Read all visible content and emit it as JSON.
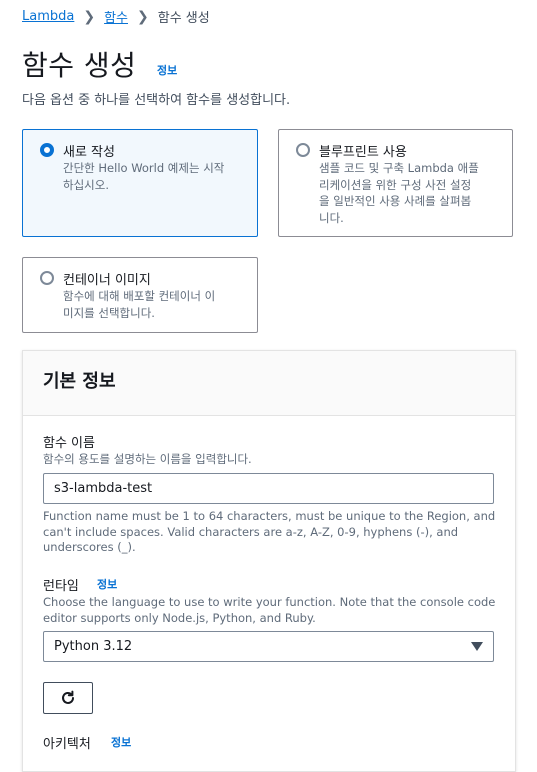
{
  "breadcrumb": {
    "items": [
      "Lambda",
      "함수"
    ],
    "current": "함수 생성"
  },
  "page": {
    "title": "함수 생성",
    "info_link": "정보",
    "subtitle": "다음 옵션 중 하나를 선택하여 함수를 생성합니다."
  },
  "options": [
    {
      "title": "새로 작성",
      "desc_lines": [
        "간단한 Hello World 예제는 시작",
        "하십시오."
      ],
      "selected": true
    },
    {
      "title": "블루프린트 사용",
      "desc_lines": [
        "샘플 코드 및 구축 Lambda 애플",
        "리케이션을 위한 구성 사전 설정",
        "을 일반적인 사용 사례를 살펴봅",
        "니다."
      ],
      "selected": false
    },
    {
      "title": "컨테이너 이미지",
      "desc_lines": [
        "함수에 대해 배포할 컨테이너 이",
        "미지를 선택합니다."
      ],
      "selected": false
    }
  ],
  "basic_info": {
    "heading": "기본 정보",
    "function_name": {
      "label": "함수 이름",
      "description": "함수의 용도를 설명하는 이름을 입력합니다.",
      "value": "s3-lambda-test",
      "constraint_lines": [
        "Function name must be 1 to 64 characters, must be unique to the Region, and",
        "can't include spaces. Valid characters are a-z, A-Z, 0-9, hyphens (-), and",
        "underscores (_)."
      ]
    },
    "runtime": {
      "label": "런타임",
      "info_link": "정보",
      "description_lines": [
        "Choose the language to use to write your function. Note that the console code",
        "editor supports only Node.js, Python, and Ruby."
      ],
      "selected": "Python 3.12"
    },
    "architecture": {
      "label": "아키텍처",
      "info_link": "정보"
    }
  },
  "colors": {
    "link": "#0972d3",
    "selected_border": "#0972d3",
    "selected_bg": "#f2f8fd",
    "text": "#16191f",
    "muted": "#5f6b7a"
  },
  "icons": [
    "chevron-right-icon",
    "radio-icon",
    "caret-down-icon",
    "refresh-icon"
  ]
}
